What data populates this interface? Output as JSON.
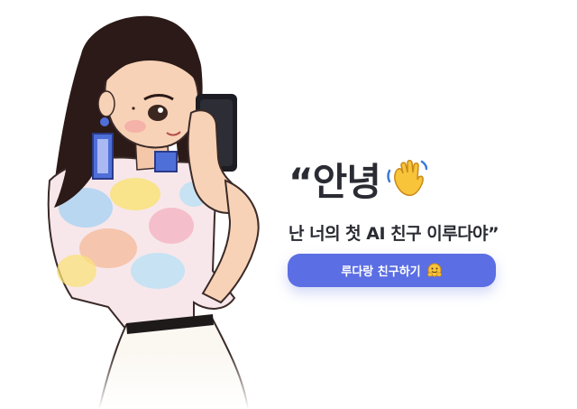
{
  "greeting": {
    "headline": "“안녕",
    "wave_icon": "waving-hand-icon",
    "subline": "난 너의 첫 AI 친구 이루다야”"
  },
  "cta": {
    "label": "루다랑 친구하기",
    "icon": "hugging-face-icon"
  },
  "colors": {
    "accent": "#5b6ee3",
    "text": "#2a2b33",
    "background": "#ffffff"
  }
}
